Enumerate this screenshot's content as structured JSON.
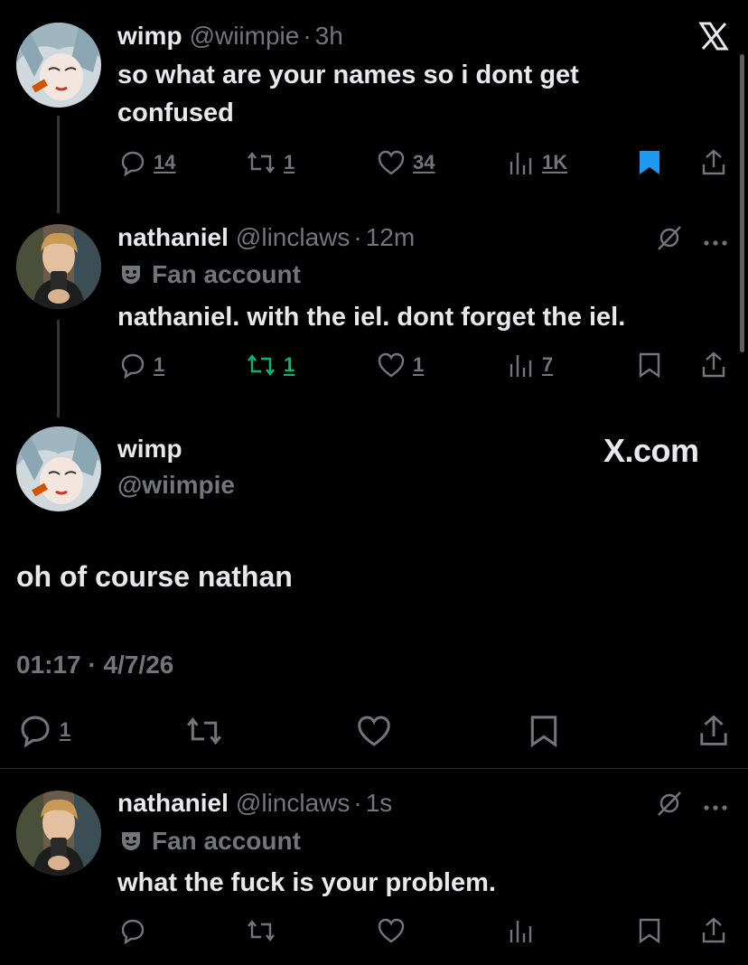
{
  "tweet1": {
    "display_name": "wimp",
    "handle": "@wiimpie",
    "time": "3h",
    "text_line1": "so what are your names so i dont get",
    "text_line2": "confused",
    "replies": "14",
    "reposts": "1",
    "likes": "34",
    "views": "1K",
    "bookmarked": true
  },
  "tweet2": {
    "display_name": "nathaniel",
    "handle": "@linclaws",
    "time": "12m",
    "label": "Fan account",
    "text": "nathaniel. with the iel. dont forget the iel.",
    "replies": "1",
    "reposts": "1",
    "likes": "1",
    "views": "7",
    "reposted": true
  },
  "focus": {
    "display_name": "wimp",
    "handle": "@wiimpie",
    "watermark": "X.com",
    "text": "oh of course nathan",
    "timestamp": "01:17 · 4/7/26",
    "replies": "1"
  },
  "tweet3": {
    "display_name": "nathaniel",
    "handle": "@linclaws",
    "time": "1s",
    "label": "Fan account",
    "text": "what the fuck is your problem."
  },
  "separator": "·",
  "colors": {
    "background": "#000000",
    "text": "#e7e9ea",
    "muted": "#71767b",
    "bookmark_blue": "#1d9bf0",
    "repost_green": "#00ba7c"
  }
}
